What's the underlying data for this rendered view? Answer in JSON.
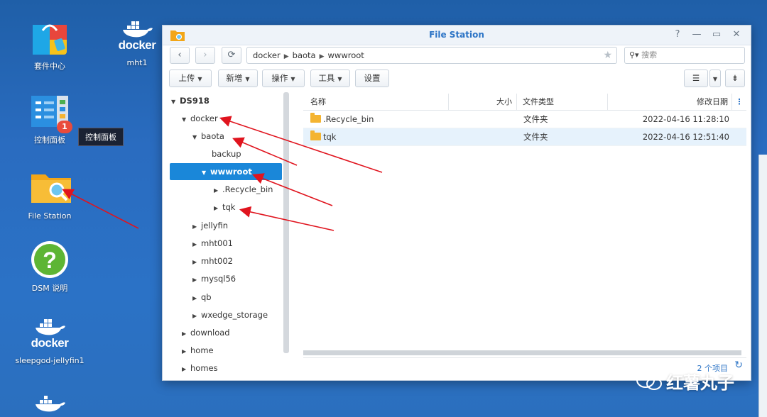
{
  "desktop": {
    "icons": [
      {
        "label": "套件中心",
        "icon": "package-center-icon"
      },
      {
        "label": "mht1",
        "icon": "docker-icon",
        "logo_text": "docker"
      },
      {
        "label": "控制面板",
        "icon": "control-panel-icon",
        "badge": "1"
      },
      {
        "label": "File Station",
        "icon": "file-station-icon"
      },
      {
        "label": "DSM 说明",
        "icon": "help-icon"
      },
      {
        "label": "sleepgod-jellyfin1",
        "icon": "docker-icon",
        "logo_text": "docker"
      }
    ],
    "tooltip": "控制面板"
  },
  "window": {
    "title": "File Station",
    "controls": [
      "?",
      "—",
      "▭",
      "✕"
    ],
    "path": [
      "docker",
      "baota",
      "wwwroot"
    ],
    "search_placeholder": "搜索",
    "toolbar": {
      "upload": "上传",
      "create": "新增",
      "action": "操作",
      "tools": "工具",
      "settings": "设置"
    },
    "tree": [
      {
        "label": "DS918"
      },
      {
        "label": "docker"
      },
      {
        "label": "baota"
      },
      {
        "label": "backup"
      },
      {
        "label": "wwwroot"
      },
      {
        "label": ".Recycle_bin"
      },
      {
        "label": "tqk"
      },
      {
        "label": "jellyfin"
      },
      {
        "label": "mht001"
      },
      {
        "label": "mht002"
      },
      {
        "label": "mysql56"
      },
      {
        "label": "qb"
      },
      {
        "label": "wxedge_storage"
      },
      {
        "label": "download"
      },
      {
        "label": "home"
      },
      {
        "label": "homes"
      }
    ],
    "columns": {
      "name": "名称",
      "size": "大小",
      "type": "文件类型",
      "modified": "修改日期"
    },
    "files": [
      {
        "name": ".Recycle_bin",
        "size": "",
        "type": "文件夹",
        "modified": "2022-04-16 11:28:10"
      },
      {
        "name": "tqk",
        "size": "",
        "type": "文件夹",
        "modified": "2022-04-16 12:51:40"
      }
    ],
    "item_count": "2 个项目"
  },
  "watermark": "红薯丸子",
  "colors": {
    "accent": "#2c74c6",
    "selection": "#1a87d9",
    "annotation_arrow": "#e0141e"
  }
}
